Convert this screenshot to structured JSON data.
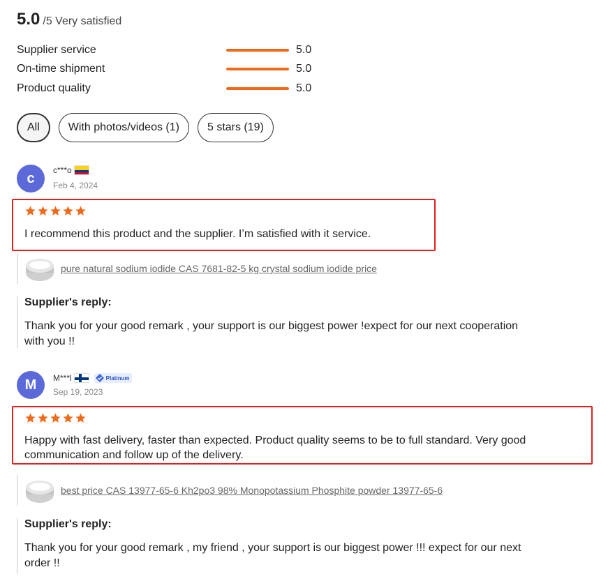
{
  "summary": {
    "score": "5.0",
    "score_suffix": "/5 Very satisfied",
    "metrics": [
      {
        "label": "Supplier service",
        "value": "5.0",
        "fill_fraction": 1.0
      },
      {
        "label": "On-time shipment",
        "value": "5.0",
        "fill_fraction": 1.0
      },
      {
        "label": "Product quality",
        "value": "5.0",
        "fill_fraction": 1.0
      }
    ]
  },
  "filters": [
    {
      "label": "All",
      "active": true
    },
    {
      "label": "With photos/videos (1)",
      "active": false
    },
    {
      "label": "5 stars (19)",
      "active": false
    }
  ],
  "reviews": [
    {
      "avatar_letter": "c",
      "avatar_color": "#5b6ad8",
      "username": "c***o",
      "country_flag": "colombia-flag",
      "date": "Feb 4, 2024",
      "rating": 5,
      "text_lines": [
        "I recommend this product and the supplier. I’m satisfied with it service."
      ],
      "product_title": "pure natural sodium iodide CAS 7681-82-5 kg crystal sodium iodide price",
      "reply_title": "Supplier's reply:",
      "reply_lines": [
        "Thank you for your good remark , your support is our biggest power !expect for our next cooperation",
        "with you !!"
      ]
    },
    {
      "avatar_letter": "M",
      "avatar_color": "#5b6ad8",
      "username": "M***l",
      "country_flag": "finland-flag",
      "badge": "Platinum",
      "date": "Sep 19, 2023",
      "rating": 5,
      "text_lines": [
        "Happy with fast delivery, faster than expected. Product quality seems to be to full standard. Very good",
        "communication and follow up of the delivery."
      ],
      "product_title": "best price CAS 13977-65-6 Kh2po3 98% Monopotassium Phosphite powder 13977-65-6",
      "reply_title": "Supplier's reply:",
      "reply_lines": [
        "Thank you for your good remark , my friend , your support is our biggest power !!! expect for our next",
        "order !!"
      ]
    }
  ],
  "colors": {
    "accent": "#ee6a1a",
    "highlight_border": "#e02020",
    "avatar": "#5b6ad8"
  }
}
